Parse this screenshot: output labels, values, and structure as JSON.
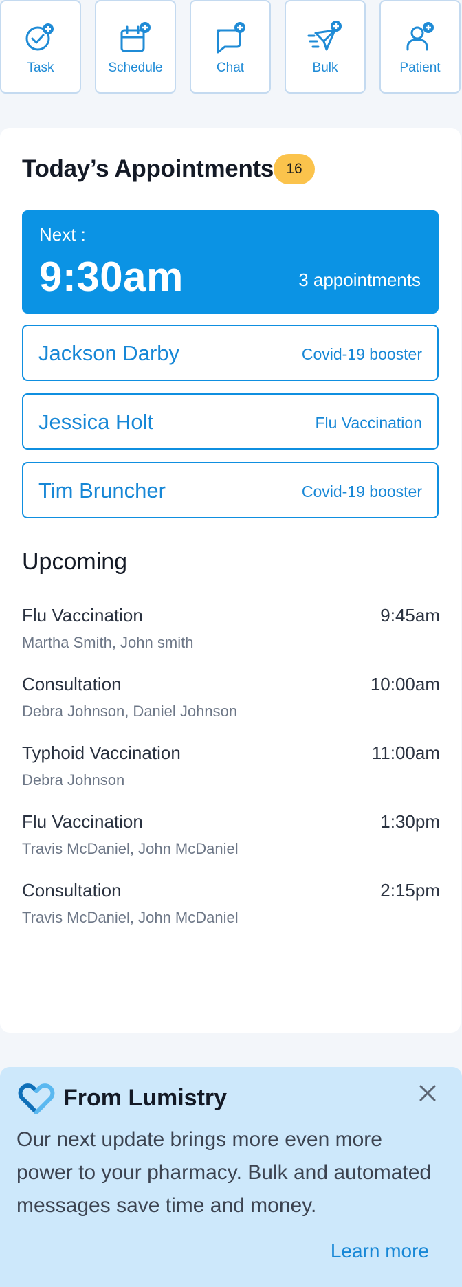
{
  "quick_actions": [
    {
      "label": "Task",
      "icon": "task-add-icon"
    },
    {
      "label": "Schedule",
      "icon": "calendar-add-icon"
    },
    {
      "label": "Chat",
      "icon": "chat-add-icon"
    },
    {
      "label": "Bulk",
      "icon": "send-add-icon"
    },
    {
      "label": "Patient",
      "icon": "patient-add-icon"
    }
  ],
  "appointments": {
    "title": "Today’s Appointments",
    "count": "16",
    "next": {
      "label": "Next :",
      "time": "9:30am",
      "count_text": "3 appointments"
    },
    "items": [
      {
        "name": "Jackson Darby",
        "type": "Covid-19 booster"
      },
      {
        "name": "Jessica Holt",
        "type": "Flu Vaccination"
      },
      {
        "name": "Tim Bruncher",
        "type": "Covid-19 booster"
      }
    ]
  },
  "upcoming": {
    "title": "Upcoming",
    "items": [
      {
        "type": "Flu Vaccination",
        "time": "9:45am",
        "names": "Martha Smith, John smith"
      },
      {
        "type": "Consultation",
        "time": "10:00am",
        "names": "Debra Johnson, Daniel Johnson"
      },
      {
        "type": "Typhoid Vaccination",
        "time": "11:00am",
        "names": "Debra Johnson"
      },
      {
        "type": "Flu Vaccination",
        "time": "1:30pm",
        "names": "Travis McDaniel, John McDaniel"
      },
      {
        "type": "Consultation",
        "time": "2:15pm",
        "names": "Travis McDaniel, John McDaniel"
      }
    ]
  },
  "banner": {
    "title": "From Lumistry",
    "text": "Our next update brings more even more power to your pharmacy. Bulk and automated messages save time and money.",
    "link": "Learn more",
    "logo_icon": "heart-logo-icon",
    "close_icon": "close-icon"
  },
  "colors": {
    "accent": "#0b93e4",
    "badge": "#fbc34c",
    "banner_bg": "#cde8fb",
    "page_bg": "#f3f6fa"
  }
}
